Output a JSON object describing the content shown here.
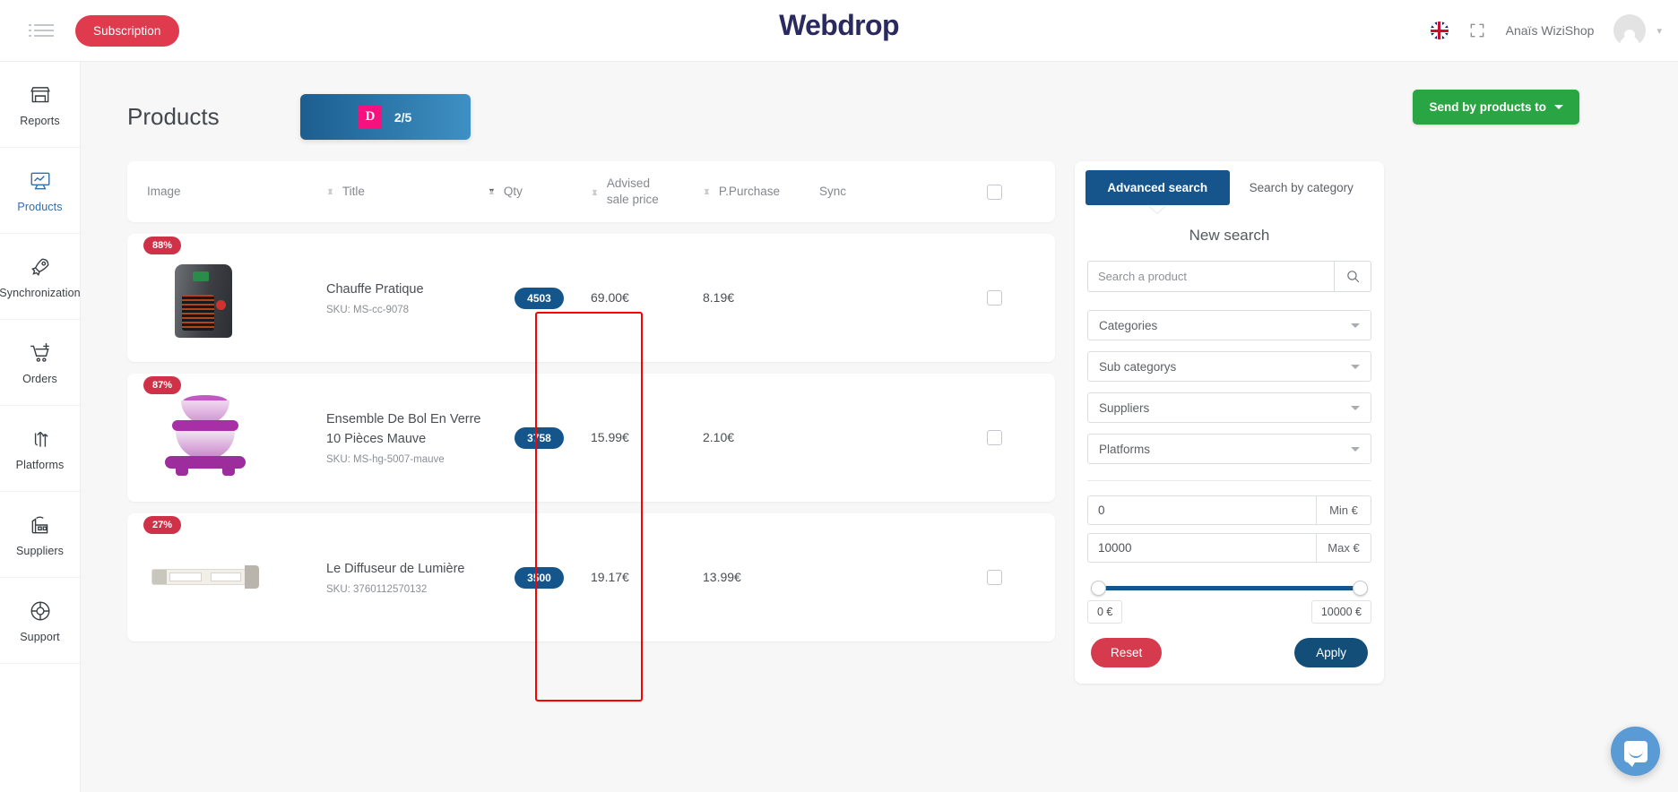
{
  "topbar": {
    "menu_icon": "hamburger-icon",
    "subscription_label": "Subscription",
    "brand": "Webdrop",
    "language_icon": "uk-flag-icon",
    "fullscreen_icon": "expand-icon",
    "username": "Anaïs WiziShop",
    "avatar_icon": "user-avatar-icon",
    "caret": "▾"
  },
  "sidebar": {
    "items": [
      {
        "label": "Reports",
        "icon": "store-icon",
        "active": false
      },
      {
        "label": "Products",
        "icon": "monitor-chart-icon",
        "active": true
      },
      {
        "label": "Synchronization",
        "icon": "rocket-icon",
        "active": false
      },
      {
        "label": "Orders",
        "icon": "cart-plus-icon",
        "active": false
      },
      {
        "label": "Platforms",
        "icon": "transfer-arrows-icon",
        "active": false
      },
      {
        "label": "Suppliers",
        "icon": "factory-icon",
        "active": false
      },
      {
        "label": "Support",
        "icon": "lifebuoy-icon",
        "active": false
      }
    ]
  },
  "page": {
    "title": "Products",
    "credit_badge": {
      "icon_letter": "D",
      "count": "2/5"
    },
    "send_button": "Send by products to"
  },
  "table": {
    "headers": [
      {
        "label": "Image",
        "sortable": false
      },
      {
        "label": "Title",
        "sortable": true,
        "sort_state": "none"
      },
      {
        "label": "Qty",
        "sortable": true,
        "sort_state": "desc"
      },
      {
        "label": "Advised sale price",
        "sortable": true,
        "sort_state": "none"
      },
      {
        "label": "P.Purchase",
        "sortable": true,
        "sort_state": "none"
      },
      {
        "label": "Sync",
        "sortable": false
      },
      {
        "label": "",
        "sortable": false
      }
    ],
    "select_all_checked": false,
    "rows": [
      {
        "discount": "88%",
        "image": "heater-product-image",
        "title": "Chauffe Pratique",
        "sku": "SKU: MS-cc-9078",
        "qty": "4503",
        "advised_sale_price": "69.00€",
        "purchase_price": "8.19€",
        "sync": "",
        "checked": false
      },
      {
        "discount": "87%",
        "image": "glass-bowls-product-image",
        "title": "Ensemble De Bol En Verre 10 Pièces Mauve",
        "sku": "SKU: MS-hg-5007-mauve",
        "qty": "3758",
        "advised_sale_price": "15.99€",
        "purchase_price": "2.10€",
        "sync": "",
        "checked": false
      },
      {
        "discount": "27%",
        "image": "light-diffuser-product-image",
        "title": "Le Diffuseur de Lumière",
        "sku": "SKU: 3760112570132",
        "qty": "3500",
        "advised_sale_price": "19.17€",
        "purchase_price": "13.99€",
        "sync": "",
        "checked": false
      }
    ]
  },
  "panel": {
    "tabs": [
      {
        "label": "Advanced search",
        "active": true
      },
      {
        "label": "Search by category",
        "active": false
      }
    ],
    "title": "New search",
    "search": {
      "value": "",
      "placeholder": "Search a product",
      "icon": "search-icon"
    },
    "filters": [
      {
        "label": "Categories"
      },
      {
        "label": "Sub categorys"
      },
      {
        "label": "Suppliers"
      },
      {
        "label": "Platforms"
      }
    ],
    "price": {
      "min_value": "0",
      "min_suffix": "Min €",
      "max_value": "10000",
      "max_suffix": "Max €",
      "slider_min_label": "0 €",
      "slider_max_label": "10000 €"
    },
    "reset_label": "Reset",
    "apply_label": "Apply"
  },
  "widgets": {
    "intercom_icon": "chat-bubble-icon"
  },
  "colors": {
    "brand_navy": "#2b2a5e",
    "subscription_red": "#e03a4e",
    "send_green": "#2aa544",
    "badge_blue": "#14558c",
    "discount_red": "#cf3148",
    "accent_pink": "#f5117e",
    "highlight_red": "#ff0000"
  }
}
